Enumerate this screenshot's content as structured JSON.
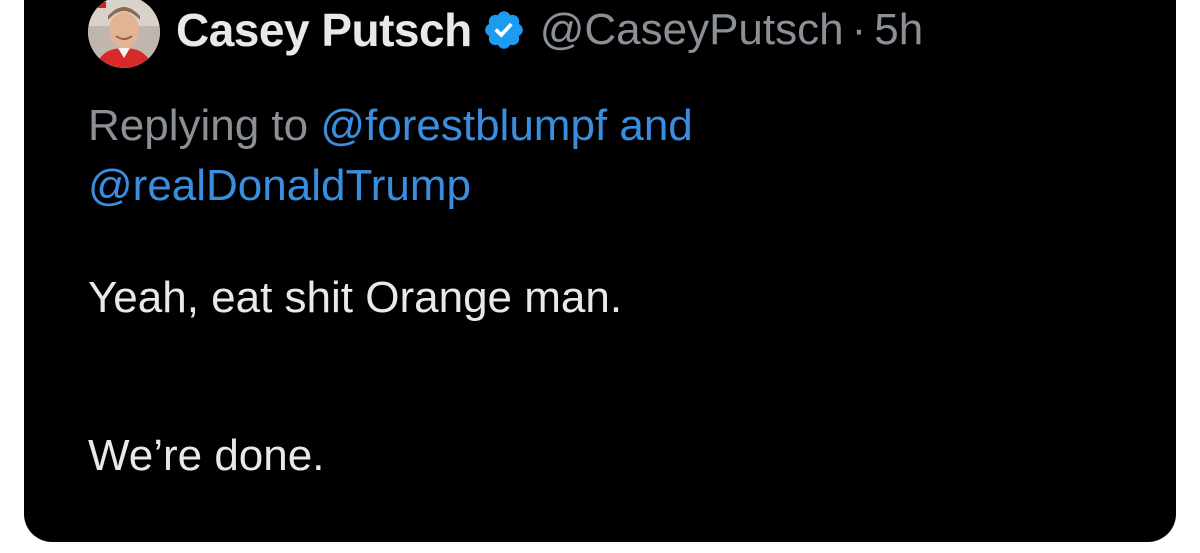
{
  "tweet": {
    "display_name": "Casey Putsch",
    "handle": "@CaseyPutsch",
    "separator": "·",
    "time": "5h",
    "verified_icon": "verified-badge-icon",
    "replying_prefix": "Replying to ",
    "reply_mention_1": "@forestblumpf",
    "reply_conjunction": " and",
    "reply_mention_2": "@realDonaldTrump",
    "text_line_1": "Yeah, eat shit Orange man.",
    "text_line_2": "We’re done."
  },
  "colors": {
    "background": "#000000",
    "primary_text": "#e7e9ea",
    "secondary_text": "#8b9096",
    "mention": "#3a8ee0",
    "verified_badge": "#1d9bf0"
  }
}
